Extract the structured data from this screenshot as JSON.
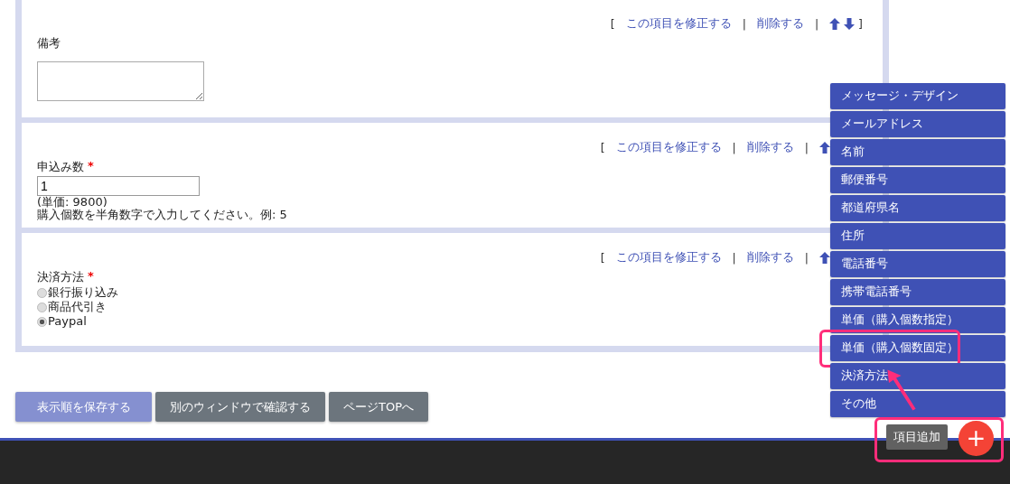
{
  "sections": [
    {
      "actions": {
        "open": "[",
        "edit": "この項目を修正する",
        "sep": "|",
        "delete": "削除する",
        "move_up": true,
        "move_down": true,
        "close": "]"
      },
      "label": "備考",
      "field": {
        "kind": "textarea"
      }
    },
    {
      "actions": {
        "open": "[",
        "edit": "この項目を修正する",
        "sep": "|",
        "delete": "削除する",
        "move_up": true
      },
      "label": "申込み数",
      "required_mark": "*",
      "field": {
        "kind": "text",
        "value": "1",
        "notes": [
          "(単価: 9800)",
          "購入個数を半角数字で入力してください。例: 5"
        ]
      }
    },
    {
      "actions": {
        "open": "[",
        "edit": "この項目を修正する",
        "sep": "|",
        "delete": "削除する",
        "move_up": true
      },
      "label": "決済方法",
      "required_mark": "*",
      "field": {
        "kind": "radio",
        "options": [
          {
            "label": "銀行振り込み",
            "selected": false
          },
          {
            "label": "商品代引き",
            "selected": false
          },
          {
            "label": "Paypal",
            "selected": true
          }
        ]
      }
    }
  ],
  "buttons": [
    {
      "label": "表示順を保存する",
      "kind": "primary"
    },
    {
      "label": "別のウィンドウで確認する",
      "kind": "secondary"
    },
    {
      "label": "ページTOPへ",
      "kind": "secondary"
    }
  ],
  "add_menu": {
    "items": [
      {
        "label": "メッセージ・デザイン",
        "highlighted": false
      },
      {
        "label": "メールアドレス",
        "highlighted": false
      },
      {
        "label": "名前",
        "highlighted": false
      },
      {
        "label": "郵便番号",
        "highlighted": false
      },
      {
        "label": "都道府県名",
        "highlighted": false
      },
      {
        "label": "住所",
        "highlighted": false
      },
      {
        "label": "電話番号",
        "highlighted": false
      },
      {
        "label": "携帯電話番号",
        "highlighted": false
      },
      {
        "label": "単価（購入個数指定）",
        "highlighted": false
      },
      {
        "label": "単価（購入個数固定）",
        "highlighted": true
      },
      {
        "label": "決済方法",
        "highlighted": false
      },
      {
        "label": "その他",
        "highlighted": false
      }
    ],
    "tooltip": "項目追加",
    "button_icon": "+",
    "highlighted": true,
    "annotation_arrow": true
  }
}
